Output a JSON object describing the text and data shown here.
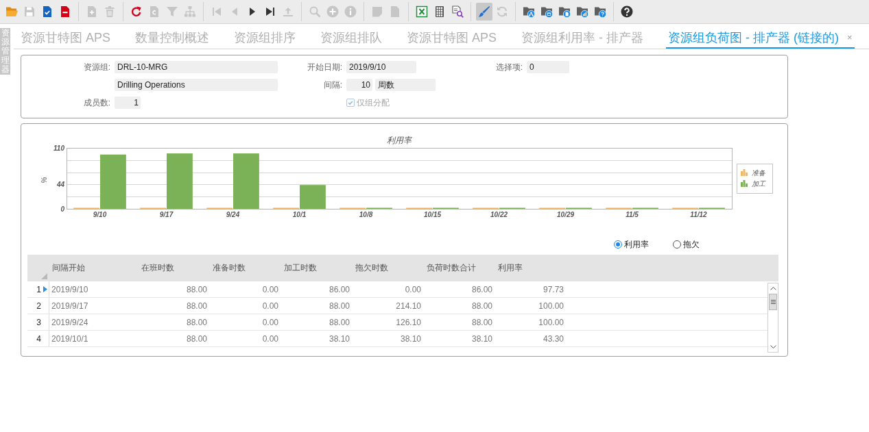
{
  "toolbar": {
    "groups": [
      [
        {
          "kind": "folder",
          "disabled": false,
          "on": false
        },
        {
          "kind": "floppy",
          "disabled": true,
          "on": false
        },
        {
          "kind": "approve",
          "disabled": false,
          "on": false
        },
        {
          "kind": "remove",
          "disabled": false,
          "on": false
        }
      ],
      [
        {
          "kind": "newdoc",
          "disabled": true,
          "on": false
        },
        {
          "kind": "trash",
          "disabled": true,
          "on": false
        }
      ],
      [
        {
          "kind": "redo",
          "disabled": false,
          "on": false
        },
        {
          "kind": "copydoc",
          "disabled": true,
          "on": false
        },
        {
          "kind": "filter",
          "disabled": true,
          "on": false
        },
        {
          "kind": "tree",
          "disabled": true,
          "on": false
        }
      ],
      [
        {
          "kind": "first",
          "disabled": true,
          "on": false
        },
        {
          "kind": "prev",
          "disabled": true,
          "on": false
        },
        {
          "kind": "next",
          "disabled": false,
          "on": false
        },
        {
          "kind": "last",
          "disabled": false,
          "on": false
        },
        {
          "kind": "upload",
          "disabled": true,
          "on": false
        }
      ],
      [
        {
          "kind": "search",
          "disabled": true,
          "on": false
        },
        {
          "kind": "add",
          "disabled": true,
          "on": false
        },
        {
          "kind": "info",
          "disabled": true,
          "on": false
        }
      ],
      [
        {
          "kind": "note",
          "disabled": true,
          "on": false
        },
        {
          "kind": "page",
          "disabled": true,
          "on": false
        }
      ],
      [
        {
          "kind": "excel",
          "disabled": false,
          "on": false
        },
        {
          "kind": "grid",
          "disabled": false,
          "on": false
        },
        {
          "kind": "preview",
          "disabled": false,
          "on": false
        }
      ],
      [
        {
          "kind": "brush",
          "disabled": false,
          "on": true
        },
        {
          "kind": "refresh",
          "disabled": true,
          "on": false
        }
      ],
      [
        {
          "kind": "orgfolder",
          "disabled": false,
          "on": false
        },
        {
          "kind": "windowfolder",
          "disabled": false,
          "on": false
        },
        {
          "kind": "docfolder",
          "disabled": false,
          "on": false
        },
        {
          "kind": "chartfolder",
          "disabled": false,
          "on": false
        },
        {
          "kind": "helpfolder",
          "disabled": false,
          "on": false
        }
      ],
      [
        {
          "kind": "help",
          "disabled": false,
          "on": false
        }
      ]
    ]
  },
  "side_panel": {
    "label": "资源管理器"
  },
  "tabs": [
    {
      "label": "资源甘特图 APS",
      "selected": false
    },
    {
      "label": "数量控制概述",
      "selected": false
    },
    {
      "label": "资源组排序",
      "selected": false
    },
    {
      "label": "资源组排队",
      "selected": false
    },
    {
      "label": "资源甘特图 APS",
      "selected": false
    },
    {
      "label": "资源组利用率 - 排产器",
      "selected": false
    },
    {
      "label": "资源组负荷图 - 排产器 (链接的)",
      "selected": true,
      "close": "×"
    }
  ],
  "form": {
    "resource_group": {
      "label": "资源组:",
      "value": "DRL-10-MRG"
    },
    "description": {
      "value": "Drilling Operations"
    },
    "member_count": {
      "label": "成员数:",
      "value": "1"
    },
    "start_date": {
      "label": "开始日期:",
      "value": "2019/9/10"
    },
    "interval": {
      "label": "间隔:",
      "value": "10",
      "unit": "周数"
    },
    "group_only": {
      "label": "仅组分配",
      "checked": true,
      "disabled": true
    },
    "selection": {
      "label": "选择项:",
      "value": "0"
    }
  },
  "chart_panel": {
    "chart_data": {
      "type": "bar",
      "title": "利用率",
      "ylabel": "%",
      "categories": [
        "9/10",
        "9/17",
        "9/24",
        "10/1",
        "10/8",
        "10/15",
        "10/22",
        "10/29",
        "11/5",
        "11/12"
      ],
      "series": [
        {
          "name": "准备",
          "color": "#f2b766",
          "values": [
            0,
            0,
            0,
            0,
            0,
            0,
            0,
            0,
            0,
            0
          ]
        },
        {
          "name": "加工",
          "color": "#7cb257",
          "values": [
            98,
            100,
            100,
            43,
            0,
            0,
            0,
            0,
            0,
            0
          ]
        }
      ],
      "ylim": [
        0,
        110
      ],
      "yticks": [
        0,
        44,
        110
      ],
      "legend": "right"
    },
    "view_options": [
      {
        "label": "利用率",
        "selected": true
      },
      {
        "label": "拖欠",
        "selected": false
      }
    ],
    "table": {
      "columns": [
        "间隔开始",
        "在班时数",
        "准备时数",
        "加工时数",
        "拖欠时数",
        "负荷时数合计",
        "利用率"
      ],
      "rows": [
        {
          "number": "1",
          "selected": true,
          "cells": [
            "2019/9/10",
            "88.00",
            "0.00",
            "86.00",
            "0.00",
            "86.00",
            "97.73"
          ]
        },
        {
          "number": "2",
          "selected": false,
          "cells": [
            "2019/9/17",
            "88.00",
            "0.00",
            "88.00",
            "214.10",
            "88.00",
            "100.00"
          ]
        },
        {
          "number": "3",
          "selected": false,
          "cells": [
            "2019/9/24",
            "88.00",
            "0.00",
            "88.00",
            "126.10",
            "88.00",
            "100.00"
          ]
        },
        {
          "number": "4",
          "selected": false,
          "cells": [
            "2019/10/1",
            "88.00",
            "0.00",
            "38.10",
            "38.10",
            "38.10",
            "43.30"
          ]
        }
      ]
    }
  }
}
